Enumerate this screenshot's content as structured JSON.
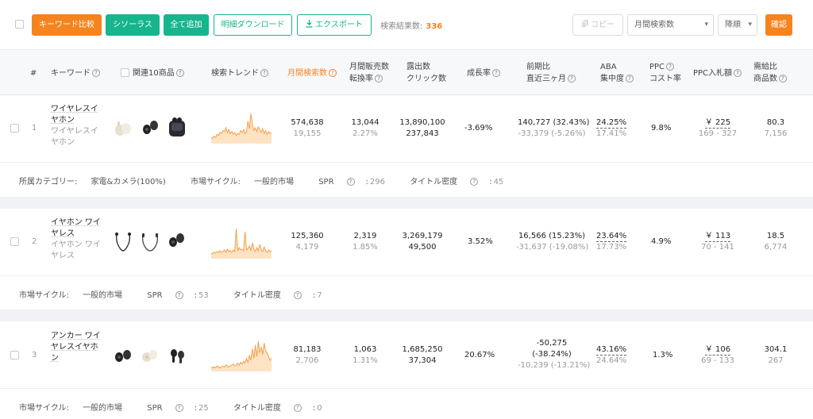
{
  "toolbar": {
    "compare": "キーワード比較",
    "thesaurus": "シソーラス",
    "add_all": "全て追加",
    "download": "明細ダウンロード",
    "export": "エクスポート",
    "result_label": "検索結果数:",
    "result_count": "336",
    "copy": "コピー",
    "sort_field": "月間検索数",
    "sort_order": "降順",
    "confirm": "確認"
  },
  "headers": {
    "index": "#",
    "keyword": "キーワード",
    "related": "関連10商品",
    "trend": "検索トレンド",
    "monthly_search": "月間検索数",
    "sales_l1": "月間販売数",
    "sales_l2": "転換率",
    "display_l1": "露出数",
    "display_l2": "クリック数",
    "growth": "成長率",
    "prev_l1": "前期比",
    "prev_l2": "直近三ヶ月",
    "aba_l1": "ABA",
    "aba_l2": "集中度",
    "ppc_l1": "PPC",
    "ppc_l2": "コスト率",
    "bid": "PPC入札額",
    "supply_l1": "需給比",
    "supply_l2": "商品数"
  },
  "colors": {
    "accent": "#f5841f",
    "green": "#17b58d",
    "spark_line": "#f5a04a",
    "spark_fill": "#fde3c4"
  },
  "rows": [
    {
      "index": "1",
      "keyword": "ワイヤレスイヤホン",
      "keyword_sub": "ワイヤレスイヤホン",
      "products": [
        "white-earbuds",
        "black-earbuds",
        "black-case-earbuds"
      ],
      "trend": [
        5,
        4,
        6,
        5,
        8,
        7,
        10,
        9,
        12,
        11,
        15,
        10,
        13,
        9,
        11,
        8,
        10,
        7,
        9,
        8,
        12,
        10,
        13,
        9,
        11,
        22,
        14,
        30,
        18,
        12,
        15,
        11,
        16,
        13,
        10,
        14,
        9,
        12,
        8,
        11,
        9,
        10
      ],
      "monthly_search": "574,638",
      "monthly_search_sub": "19,155",
      "sales": "13,044",
      "conversion": "2.27%",
      "display": "13,890,100",
      "clicks": "237,843",
      "growth": "-3.69%",
      "prev_period": "140,727 (32.43%)",
      "prev_3m": "-33,379 (-5.26%)",
      "aba": "24.25%",
      "aba_sub": "17.41%",
      "ppc": "9.8%",
      "bid": "￥ 225",
      "bid_range": "169 - 327",
      "supply": "80.3",
      "supply_sub": "7,156",
      "meta": {
        "category_label": "所属カテゴリー:",
        "category": "家電&カメラ(100%)",
        "cycle_label": "市場サイクル:",
        "cycle": "一般的市場",
        "spr_label": "SPR",
        "spr": "296",
        "title_label": "タイトル密度",
        "title_density": "45"
      }
    },
    {
      "index": "2",
      "keyword": "イヤホン ワイヤレス",
      "keyword_sub": "イヤホン ワイヤレス",
      "products": [
        "neckband-earphones",
        "neckband-earphones-2",
        "black-earbuds"
      ],
      "trend": [
        4,
        5,
        6,
        5,
        7,
        6,
        8,
        6,
        7,
        9,
        6,
        10,
        7,
        8,
        6,
        9,
        7,
        36,
        8,
        12,
        9,
        10,
        8,
        32,
        9,
        11,
        14,
        8,
        18,
        10,
        7,
        12,
        8,
        16,
        9,
        7,
        13,
        8,
        6,
        9,
        7,
        8
      ],
      "monthly_search": "125,360",
      "monthly_search_sub": "4,179",
      "sales": "2,319",
      "conversion": "1.85%",
      "display": "3,269,179",
      "clicks": "49,500",
      "growth": "3.52%",
      "prev_period": "16,566 (15.23%)",
      "prev_3m": "-31,637 (-19.08%)",
      "aba": "23.64%",
      "aba_sub": "17.73%",
      "ppc": "4.9%",
      "bid": "￥ 113",
      "bid_range": "70 - 141",
      "supply": "18.5",
      "supply_sub": "6,774",
      "meta": {
        "category_label": "",
        "category": "",
        "cycle_label": "市場サイクル:",
        "cycle": "一般的市場",
        "spr_label": "SPR",
        "spr": "53",
        "title_label": "タイトル密度",
        "title_density": "7"
      }
    },
    {
      "index": "3",
      "keyword": "アンカー ワイヤレスイヤホン",
      "keyword_sub": "",
      "products": [
        "black-earbuds",
        "white-earbuds",
        "black-stem-earbuds"
      ],
      "trend": [
        3,
        2,
        3,
        2,
        4,
        3,
        2,
        3,
        4,
        3,
        5,
        4,
        3,
        4,
        5,
        6,
        4,
        5,
        7,
        5,
        8,
        6,
        9,
        7,
        12,
        8,
        15,
        10,
        22,
        12,
        26,
        14,
        30,
        18,
        24,
        16,
        28,
        20,
        18,
        14,
        10,
        12
      ],
      "monthly_search": "81,183",
      "monthly_search_sub": "2,706",
      "sales": "1,063",
      "conversion": "1.31%",
      "display": "1,685,250",
      "clicks": "37,304",
      "growth": "20.67%",
      "prev_period_l1": "-50,275",
      "prev_period_l2": "(-38.24%)",
      "prev_3m": "-10,239 (-13.21%)",
      "aba": "43.16%",
      "aba_sub": "24.64%",
      "ppc": "1.3%",
      "bid": "￥ 106",
      "bid_range": "69 - 133",
      "supply": "304.1",
      "supply_sub": "267",
      "meta": {
        "category_label": "",
        "category": "",
        "cycle_label": "市場サイクル:",
        "cycle": "一般的市場",
        "spr_label": "SPR",
        "spr": "25",
        "title_label": "タイトル密度",
        "title_density": "0"
      }
    }
  ]
}
